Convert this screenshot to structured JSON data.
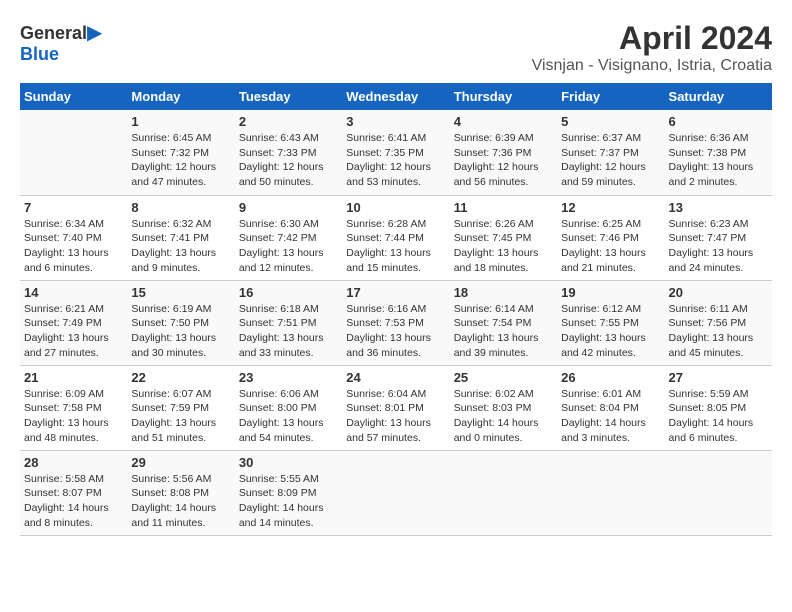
{
  "logo": {
    "text_general": "General",
    "text_blue": "Blue",
    "icon": "▶"
  },
  "title": "April 2024",
  "location": "Visnjan - Visignano, Istria, Croatia",
  "days_of_week": [
    "Sunday",
    "Monday",
    "Tuesday",
    "Wednesday",
    "Thursday",
    "Friday",
    "Saturday"
  ],
  "weeks": [
    [
      {
        "day": "",
        "info": ""
      },
      {
        "day": "1",
        "info": "Sunrise: 6:45 AM\nSunset: 7:32 PM\nDaylight: 12 hours\nand 47 minutes."
      },
      {
        "day": "2",
        "info": "Sunrise: 6:43 AM\nSunset: 7:33 PM\nDaylight: 12 hours\nand 50 minutes."
      },
      {
        "day": "3",
        "info": "Sunrise: 6:41 AM\nSunset: 7:35 PM\nDaylight: 12 hours\nand 53 minutes."
      },
      {
        "day": "4",
        "info": "Sunrise: 6:39 AM\nSunset: 7:36 PM\nDaylight: 12 hours\nand 56 minutes."
      },
      {
        "day": "5",
        "info": "Sunrise: 6:37 AM\nSunset: 7:37 PM\nDaylight: 12 hours\nand 59 minutes."
      },
      {
        "day": "6",
        "info": "Sunrise: 6:36 AM\nSunset: 7:38 PM\nDaylight: 13 hours\nand 2 minutes."
      }
    ],
    [
      {
        "day": "7",
        "info": "Sunrise: 6:34 AM\nSunset: 7:40 PM\nDaylight: 13 hours\nand 6 minutes."
      },
      {
        "day": "8",
        "info": "Sunrise: 6:32 AM\nSunset: 7:41 PM\nDaylight: 13 hours\nand 9 minutes."
      },
      {
        "day": "9",
        "info": "Sunrise: 6:30 AM\nSunset: 7:42 PM\nDaylight: 13 hours\nand 12 minutes."
      },
      {
        "day": "10",
        "info": "Sunrise: 6:28 AM\nSunset: 7:44 PM\nDaylight: 13 hours\nand 15 minutes."
      },
      {
        "day": "11",
        "info": "Sunrise: 6:26 AM\nSunset: 7:45 PM\nDaylight: 13 hours\nand 18 minutes."
      },
      {
        "day": "12",
        "info": "Sunrise: 6:25 AM\nSunset: 7:46 PM\nDaylight: 13 hours\nand 21 minutes."
      },
      {
        "day": "13",
        "info": "Sunrise: 6:23 AM\nSunset: 7:47 PM\nDaylight: 13 hours\nand 24 minutes."
      }
    ],
    [
      {
        "day": "14",
        "info": "Sunrise: 6:21 AM\nSunset: 7:49 PM\nDaylight: 13 hours\nand 27 minutes."
      },
      {
        "day": "15",
        "info": "Sunrise: 6:19 AM\nSunset: 7:50 PM\nDaylight: 13 hours\nand 30 minutes."
      },
      {
        "day": "16",
        "info": "Sunrise: 6:18 AM\nSunset: 7:51 PM\nDaylight: 13 hours\nand 33 minutes."
      },
      {
        "day": "17",
        "info": "Sunrise: 6:16 AM\nSunset: 7:53 PM\nDaylight: 13 hours\nand 36 minutes."
      },
      {
        "day": "18",
        "info": "Sunrise: 6:14 AM\nSunset: 7:54 PM\nDaylight: 13 hours\nand 39 minutes."
      },
      {
        "day": "19",
        "info": "Sunrise: 6:12 AM\nSunset: 7:55 PM\nDaylight: 13 hours\nand 42 minutes."
      },
      {
        "day": "20",
        "info": "Sunrise: 6:11 AM\nSunset: 7:56 PM\nDaylight: 13 hours\nand 45 minutes."
      }
    ],
    [
      {
        "day": "21",
        "info": "Sunrise: 6:09 AM\nSunset: 7:58 PM\nDaylight: 13 hours\nand 48 minutes."
      },
      {
        "day": "22",
        "info": "Sunrise: 6:07 AM\nSunset: 7:59 PM\nDaylight: 13 hours\nand 51 minutes."
      },
      {
        "day": "23",
        "info": "Sunrise: 6:06 AM\nSunset: 8:00 PM\nDaylight: 13 hours\nand 54 minutes."
      },
      {
        "day": "24",
        "info": "Sunrise: 6:04 AM\nSunset: 8:01 PM\nDaylight: 13 hours\nand 57 minutes."
      },
      {
        "day": "25",
        "info": "Sunrise: 6:02 AM\nSunset: 8:03 PM\nDaylight: 14 hours\nand 0 minutes."
      },
      {
        "day": "26",
        "info": "Sunrise: 6:01 AM\nSunset: 8:04 PM\nDaylight: 14 hours\nand 3 minutes."
      },
      {
        "day": "27",
        "info": "Sunrise: 5:59 AM\nSunset: 8:05 PM\nDaylight: 14 hours\nand 6 minutes."
      }
    ],
    [
      {
        "day": "28",
        "info": "Sunrise: 5:58 AM\nSunset: 8:07 PM\nDaylight: 14 hours\nand 8 minutes."
      },
      {
        "day": "29",
        "info": "Sunrise: 5:56 AM\nSunset: 8:08 PM\nDaylight: 14 hours\nand 11 minutes."
      },
      {
        "day": "30",
        "info": "Sunrise: 5:55 AM\nSunset: 8:09 PM\nDaylight: 14 hours\nand 14 minutes."
      },
      {
        "day": "",
        "info": ""
      },
      {
        "day": "",
        "info": ""
      },
      {
        "day": "",
        "info": ""
      },
      {
        "day": "",
        "info": ""
      }
    ]
  ]
}
